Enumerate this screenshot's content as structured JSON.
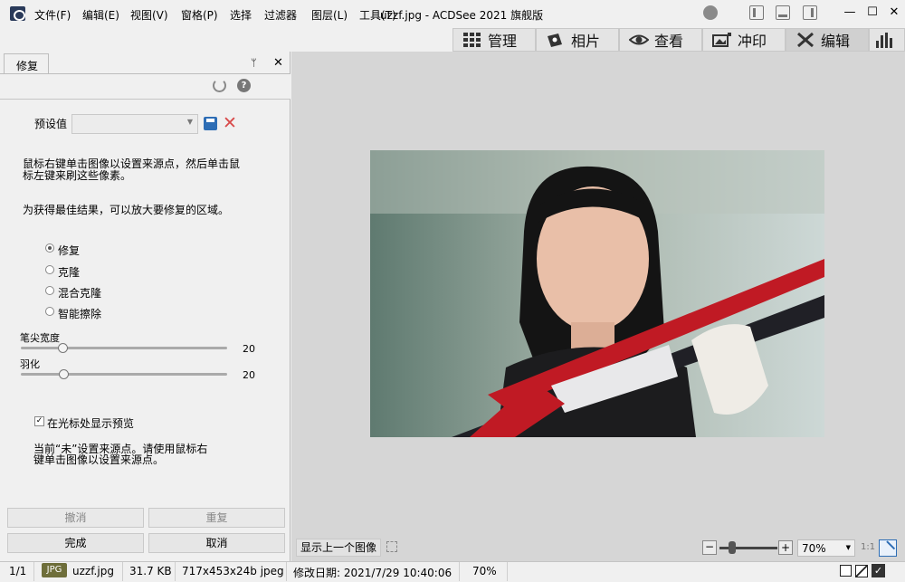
{
  "window": {
    "title": "uzzf.jpg - ACDSee 2021 旗舰版",
    "menus": [
      "文件(F)",
      "编辑(E)",
      "视图(V)",
      "窗格(P)",
      "选择",
      "过滤器",
      "图层(L)",
      "工具(T)"
    ]
  },
  "modes": [
    {
      "label": "管理",
      "icon": "grid-icon"
    },
    {
      "label": "相片",
      "icon": "photos-icon"
    },
    {
      "label": "查看",
      "icon": "eye-icon"
    },
    {
      "label": "冲印",
      "icon": "develop-icon"
    },
    {
      "label": "编辑",
      "icon": "edit-icon"
    },
    {
      "label": "",
      "icon": "histogram-icon"
    }
  ],
  "panel": {
    "tab": "修复",
    "preset_label": "预设值",
    "preset_value": "",
    "instruction1": "鼠标右键单击图像以设置来源点，然后单击鼠标左键来刷这些像素。",
    "instruction1_line1": "鼠标右键单击图像以设置来源点，然后单击鼠",
    "instruction1_line2": "标左键来刷这些像素。",
    "instruction2": "为获得最佳结果，可以放大要修复的区域。",
    "modes": [
      "修复",
      "克隆",
      "混合克隆",
      "智能擦除"
    ],
    "selected_mode": "修复",
    "brush_width_label": "笔尖宽度",
    "brush_width": 20,
    "feather_label": "羽化",
    "feather": 20,
    "preview_checkbox": "在光标处显示预览",
    "preview_checked": true,
    "source_status_line1": "当前“未”设置来源点。请使用鼠标右",
    "source_status_line2": "键单击图像以设置来源点。",
    "undo": "撤消",
    "redo": "重复",
    "done": "完成",
    "cancel": "取消"
  },
  "viewer": {
    "show_prev": "显示上一个图像",
    "zoom_value": "70%",
    "ratio": "1:1"
  },
  "status": {
    "index": "1/1",
    "format_badge": "JPG",
    "filename": "uzzf.jpg",
    "filesize": "31.7 KB",
    "dimensions": "717x453x24b jpeg",
    "modified": "修改日期: 2021/7/29 10:40:06",
    "zoom": "70%"
  },
  "colors": {
    "accent_blue": "#2d6db5",
    "red_x": "#d84a4a"
  }
}
